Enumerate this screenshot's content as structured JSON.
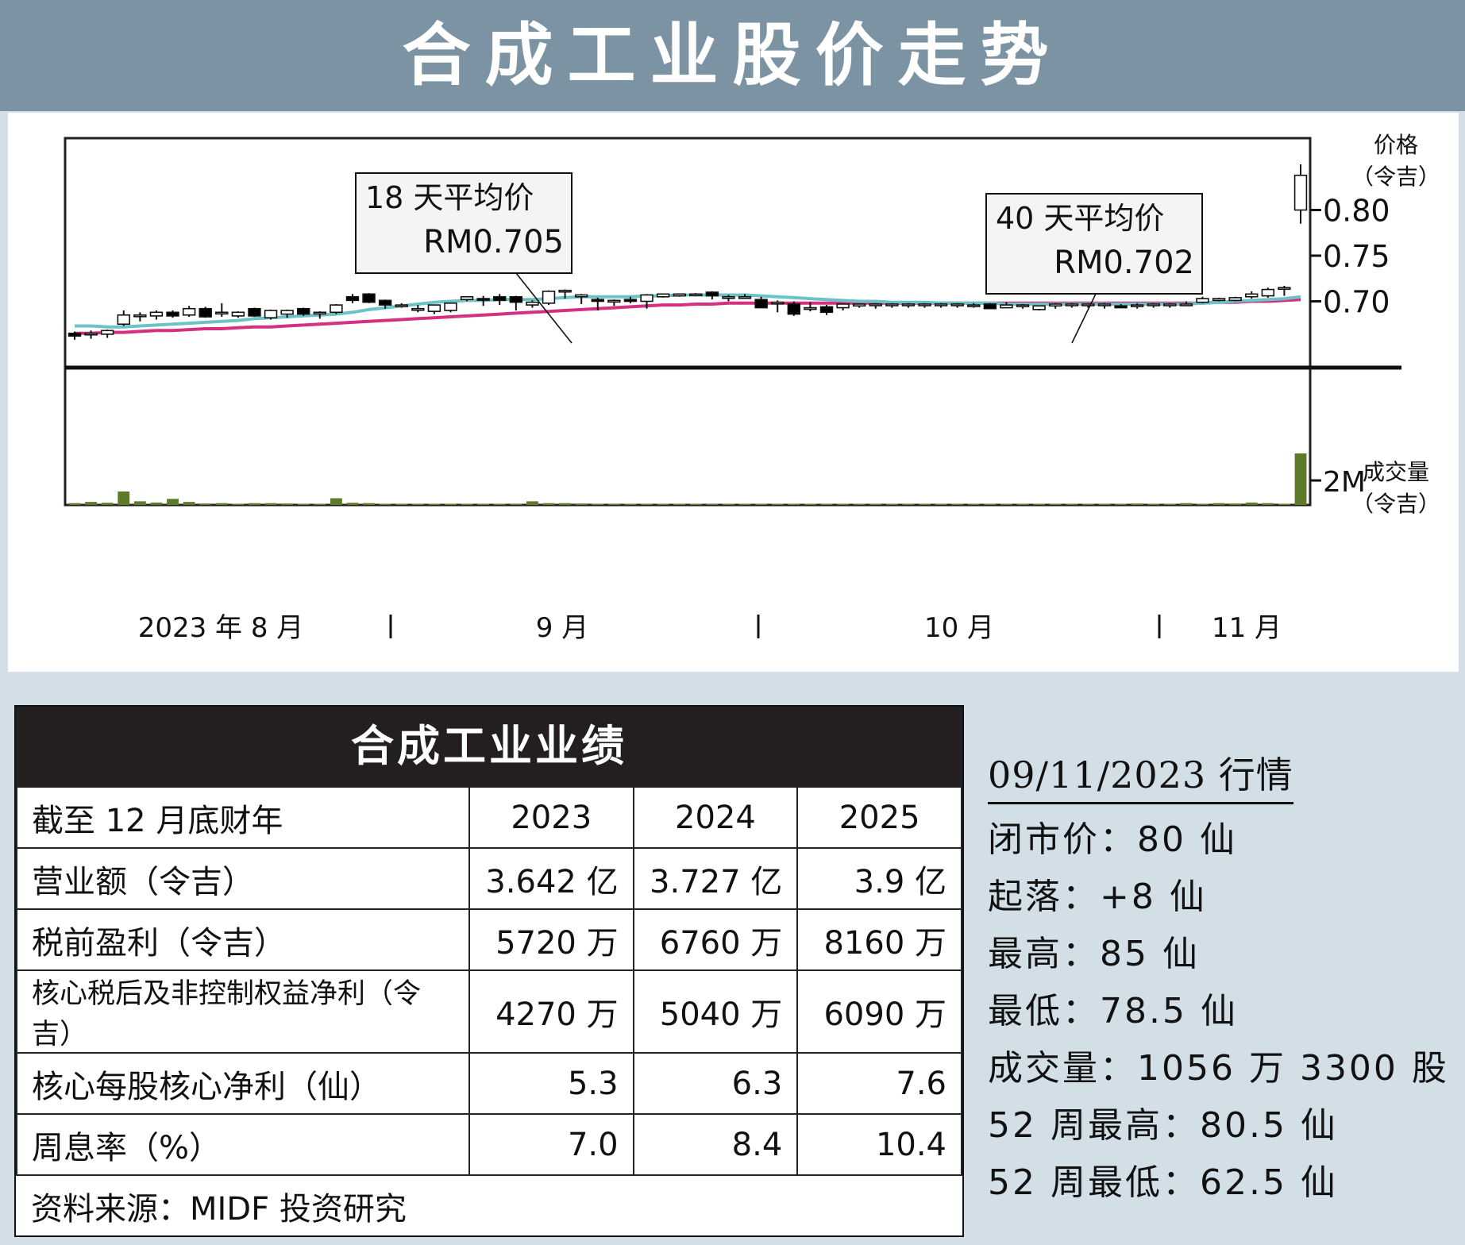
{
  "title": "合成工业股价走势",
  "chart_data": {
    "type": "candlestick",
    "price_axis": {
      "label": "价格",
      "unit": "（令吉）",
      "ticks": [
        0.8,
        0.75,
        0.7
      ],
      "tick_labels": [
        "0.80",
        "0.75",
        "0.70"
      ],
      "ylim": [
        0.63,
        0.87
      ]
    },
    "volume_axis": {
      "label": "成交量",
      "unit": "（令吉）",
      "ticks": [
        2
      ],
      "tick_labels": [
        "2M"
      ],
      "ylim": [
        0,
        11
      ]
    },
    "x_labels": [
      "2023 年 8 月",
      "9 月",
      "10 月",
      "11 月"
    ],
    "annotations": [
      {
        "line1": "18 天平均价",
        "line2": "RM0.705"
      },
      {
        "line1": "40 天平均价",
        "line2": "RM0.702"
      }
    ],
    "colors": {
      "ma18": "#6cc3c6",
      "ma40": "#d4307f",
      "volume": "#5c7a2a",
      "up": "#ffffff",
      "down": "#000000"
    },
    "candles": [
      {
        "o": 0.665,
        "h": 0.667,
        "l": 0.658,
        "c": 0.662
      },
      {
        "o": 0.665,
        "h": 0.668,
        "l": 0.659,
        "c": 0.665
      },
      {
        "o": 0.664,
        "h": 0.669,
        "l": 0.66,
        "c": 0.668
      },
      {
        "o": 0.675,
        "h": 0.69,
        "l": 0.673,
        "c": 0.685
      },
      {
        "o": 0.685,
        "h": 0.688,
        "l": 0.678,
        "c": 0.685
      },
      {
        "o": 0.684,
        "h": 0.69,
        "l": 0.68,
        "c": 0.688
      },
      {
        "o": 0.688,
        "h": 0.69,
        "l": 0.682,
        "c": 0.684
      },
      {
        "o": 0.685,
        "h": 0.695,
        "l": 0.683,
        "c": 0.692
      },
      {
        "o": 0.692,
        "h": 0.694,
        "l": 0.682,
        "c": 0.683
      },
      {
        "o": 0.688,
        "h": 0.698,
        "l": 0.683,
        "c": 0.688
      },
      {
        "o": 0.684,
        "h": 0.689,
        "l": 0.682,
        "c": 0.688
      },
      {
        "o": 0.692,
        "h": 0.693,
        "l": 0.683,
        "c": 0.684
      },
      {
        "o": 0.682,
        "h": 0.691,
        "l": 0.68,
        "c": 0.69
      },
      {
        "o": 0.686,
        "h": 0.691,
        "l": 0.682,
        "c": 0.69
      },
      {
        "o": 0.692,
        "h": 0.693,
        "l": 0.684,
        "c": 0.686
      },
      {
        "o": 0.688,
        "h": 0.689,
        "l": 0.681,
        "c": 0.688
      },
      {
        "o": 0.688,
        "h": 0.697,
        "l": 0.686,
        "c": 0.696
      },
      {
        "o": 0.705,
        "h": 0.708,
        "l": 0.698,
        "c": 0.701
      },
      {
        "o": 0.708,
        "h": 0.709,
        "l": 0.698,
        "c": 0.699
      },
      {
        "o": 0.701,
        "h": 0.702,
        "l": 0.692,
        "c": 0.696
      },
      {
        "o": 0.696,
        "h": 0.698,
        "l": 0.693,
        "c": 0.696
      },
      {
        "o": 0.692,
        "h": 0.696,
        "l": 0.688,
        "c": 0.692
      },
      {
        "o": 0.689,
        "h": 0.696,
        "l": 0.686,
        "c": 0.696
      },
      {
        "o": 0.69,
        "h": 0.698,
        "l": 0.688,
        "c": 0.698
      },
      {
        "o": 0.702,
        "h": 0.705,
        "l": 0.7,
        "c": 0.705
      },
      {
        "o": 0.703,
        "h": 0.706,
        "l": 0.695,
        "c": 0.702
      },
      {
        "o": 0.705,
        "h": 0.708,
        "l": 0.696,
        "c": 0.701
      },
      {
        "o": 0.705,
        "h": 0.706,
        "l": 0.69,
        "c": 0.699
      },
      {
        "o": 0.696,
        "h": 0.701,
        "l": 0.693,
        "c": 0.699
      },
      {
        "o": 0.698,
        "h": 0.712,
        "l": 0.696,
        "c": 0.711
      },
      {
        "o": 0.712,
        "h": 0.713,
        "l": 0.703,
        "c": 0.712
      },
      {
        "o": 0.705,
        "h": 0.708,
        "l": 0.697,
        "c": 0.707
      },
      {
        "o": 0.702,
        "h": 0.704,
        "l": 0.69,
        "c": 0.7
      },
      {
        "o": 0.701,
        "h": 0.702,
        "l": 0.695,
        "c": 0.701
      },
      {
        "o": 0.702,
        "h": 0.705,
        "l": 0.698,
        "c": 0.7
      },
      {
        "o": 0.7,
        "h": 0.708,
        "l": 0.692,
        "c": 0.707
      },
      {
        "o": 0.705,
        "h": 0.708,
        "l": 0.704,
        "c": 0.708
      },
      {
        "o": 0.706,
        "h": 0.708,
        "l": 0.705,
        "c": 0.708
      },
      {
        "o": 0.707,
        "h": 0.709,
        "l": 0.706,
        "c": 0.708
      },
      {
        "o": 0.71,
        "h": 0.711,
        "l": 0.702,
        "c": 0.706
      },
      {
        "o": 0.704,
        "h": 0.707,
        "l": 0.7,
        "c": 0.705
      },
      {
        "o": 0.705,
        "h": 0.708,
        "l": 0.703,
        "c": 0.705
      },
      {
        "o": 0.702,
        "h": 0.705,
        "l": 0.693,
        "c": 0.693
      },
      {
        "o": 0.699,
        "h": 0.701,
        "l": 0.688,
        "c": 0.699
      },
      {
        "o": 0.697,
        "h": 0.7,
        "l": 0.684,
        "c": 0.686
      },
      {
        "o": 0.693,
        "h": 0.699,
        "l": 0.689,
        "c": 0.693
      },
      {
        "o": 0.694,
        "h": 0.696,
        "l": 0.685,
        "c": 0.688
      },
      {
        "o": 0.693,
        "h": 0.697,
        "l": 0.69,
        "c": 0.697
      },
      {
        "o": 0.695,
        "h": 0.697,
        "l": 0.693,
        "c": 0.697
      },
      {
        "o": 0.697,
        "h": 0.698,
        "l": 0.692,
        "c": 0.697
      },
      {
        "o": 0.697,
        "h": 0.698,
        "l": 0.693,
        "c": 0.697
      },
      {
        "o": 0.697,
        "h": 0.698,
        "l": 0.693,
        "c": 0.697
      },
      {
        "o": 0.697,
        "h": 0.698,
        "l": 0.693,
        "c": 0.697
      },
      {
        "o": 0.697,
        "h": 0.698,
        "l": 0.693,
        "c": 0.697
      },
      {
        "o": 0.697,
        "h": 0.698,
        "l": 0.693,
        "c": 0.697
      },
      {
        "o": 0.695,
        "h": 0.698,
        "l": 0.693,
        "c": 0.696
      },
      {
        "o": 0.697,
        "h": 0.698,
        "l": 0.692,
        "c": 0.692
      },
      {
        "o": 0.693,
        "h": 0.699,
        "l": 0.693,
        "c": 0.696
      },
      {
        "o": 0.696,
        "h": 0.697,
        "l": 0.692,
        "c": 0.696
      },
      {
        "o": 0.691,
        "h": 0.695,
        "l": 0.69,
        "c": 0.695
      },
      {
        "o": 0.695,
        "h": 0.698,
        "l": 0.692,
        "c": 0.697
      },
      {
        "o": 0.697,
        "h": 0.698,
        "l": 0.693,
        "c": 0.697
      },
      {
        "o": 0.697,
        "h": 0.698,
        "l": 0.693,
        "c": 0.697
      },
      {
        "o": 0.697,
        "h": 0.698,
        "l": 0.692,
        "c": 0.697
      },
      {
        "o": 0.695,
        "h": 0.697,
        "l": 0.693,
        "c": 0.693
      },
      {
        "o": 0.696,
        "h": 0.698,
        "l": 0.692,
        "c": 0.696
      },
      {
        "o": 0.697,
        "h": 0.698,
        "l": 0.693,
        "c": 0.697
      },
      {
        "o": 0.697,
        "h": 0.698,
        "l": 0.693,
        "c": 0.697
      },
      {
        "o": 0.697,
        "h": 0.7,
        "l": 0.695,
        "c": 0.697
      },
      {
        "o": 0.699,
        "h": 0.705,
        "l": 0.698,
        "c": 0.703
      },
      {
        "o": 0.701,
        "h": 0.704,
        "l": 0.7,
        "c": 0.703
      },
      {
        "o": 0.701,
        "h": 0.705,
        "l": 0.7,
        "c": 0.704
      },
      {
        "o": 0.705,
        "h": 0.711,
        "l": 0.703,
        "c": 0.708
      },
      {
        "o": 0.706,
        "h": 0.715,
        "l": 0.704,
        "c": 0.713
      },
      {
        "o": 0.715,
        "h": 0.717,
        "l": 0.706,
        "c": 0.715
      },
      {
        "o": 0.8,
        "h": 0.85,
        "l": 0.785,
        "c": 0.838
      }
    ],
    "ma18": [
      0.673,
      0.673,
      0.672,
      0.672,
      0.673,
      0.674,
      0.675,
      0.676,
      0.677,
      0.678,
      0.679,
      0.681,
      0.682,
      0.683,
      0.684,
      0.685,
      0.686,
      0.688,
      0.691,
      0.693,
      0.695,
      0.697,
      0.699,
      0.7,
      0.701,
      0.701,
      0.702,
      0.702,
      0.702,
      0.703,
      0.704,
      0.705,
      0.705,
      0.705,
      0.705,
      0.706,
      0.706,
      0.707,
      0.707,
      0.707,
      0.707,
      0.707,
      0.706,
      0.705,
      0.704,
      0.703,
      0.702,
      0.701,
      0.7,
      0.7,
      0.699,
      0.699,
      0.699,
      0.698,
      0.698,
      0.698,
      0.698,
      0.697,
      0.697,
      0.697,
      0.697,
      0.697,
      0.697,
      0.697,
      0.697,
      0.697,
      0.697,
      0.697,
      0.697,
      0.698,
      0.699,
      0.7,
      0.701,
      0.702,
      0.703,
      0.705
    ],
    "ma40": [
      0.665,
      0.665,
      0.666,
      0.666,
      0.667,
      0.668,
      0.668,
      0.669,
      0.67,
      0.67,
      0.671,
      0.672,
      0.672,
      0.673,
      0.674,
      0.675,
      0.676,
      0.677,
      0.678,
      0.679,
      0.68,
      0.681,
      0.682,
      0.683,
      0.684,
      0.685,
      0.686,
      0.687,
      0.688,
      0.689,
      0.69,
      0.691,
      0.692,
      0.693,
      0.694,
      0.695,
      0.696,
      0.696,
      0.697,
      0.697,
      0.698,
      0.698,
      0.698,
      0.698,
      0.698,
      0.698,
      0.698,
      0.698,
      0.698,
      0.698,
      0.698,
      0.698,
      0.698,
      0.698,
      0.698,
      0.698,
      0.698,
      0.698,
      0.698,
      0.698,
      0.698,
      0.698,
      0.698,
      0.698,
      0.698,
      0.698,
      0.698,
      0.698,
      0.698,
      0.698,
      0.699,
      0.699,
      0.7,
      0.7,
      0.701,
      0.702
    ],
    "volume": [
      0.15,
      0.25,
      0.18,
      1.1,
      0.3,
      0.2,
      0.5,
      0.25,
      0.12,
      0.15,
      0.1,
      0.15,
      0.15,
      0.12,
      0.1,
      0.1,
      0.55,
      0.18,
      0.15,
      0.1,
      0.1,
      0.1,
      0.1,
      0.1,
      0.1,
      0.1,
      0.1,
      0.08,
      0.3,
      0.15,
      0.15,
      0.12,
      0.1,
      0.08,
      0.1,
      0.1,
      0.1,
      0.1,
      0.1,
      0.08,
      0.1,
      0.1,
      0.1,
      0.1,
      0.1,
      0.1,
      0.1,
      0.1,
      0.1,
      0.1,
      0.1,
      0.1,
      0.1,
      0.1,
      0.1,
      0.1,
      0.1,
      0.1,
      0.1,
      0.1,
      0.1,
      0.1,
      0.1,
      0.1,
      0.1,
      0.12,
      0.1,
      0.1,
      0.15,
      0.1,
      0.15,
      0.12,
      0.2,
      0.15,
      0.1,
      4.2
    ]
  },
  "performance": {
    "title": "合成工业业绩",
    "header": [
      "截至 12 月底财年",
      "2023",
      "2024",
      "2025"
    ],
    "rows": [
      {
        "label": "营业额（令吉）",
        "values": [
          "3.642 亿",
          "3.727 亿",
          "3.9 亿"
        ]
      },
      {
        "label": "税前盈利（令吉）",
        "values": [
          "5720 万",
          "6760 万",
          "8160 万"
        ]
      },
      {
        "label": "核心税后及非控制权益净利（令吉）",
        "values": [
          "4270 万",
          "5040 万",
          "6090 万"
        ]
      },
      {
        "label": "核心每股核心净利（仙）",
        "values": [
          "5.3",
          "6.3",
          "7.6"
        ]
      },
      {
        "label": "周息率（%）",
        "values": [
          "7.0",
          "8.4",
          "10.4"
        ]
      }
    ],
    "source": "资料来源：MIDF 投资研究"
  },
  "quote": {
    "date": "09/11/2023 行情",
    "lines": [
      "闭市价：80 仙",
      "起落：+8 仙",
      "最高：85 仙",
      "最低：78.5 仙",
      "成交量：1056 万 3300 股",
      "52 周最高：80.5 仙",
      "52 周最低：62.5 仙"
    ]
  }
}
